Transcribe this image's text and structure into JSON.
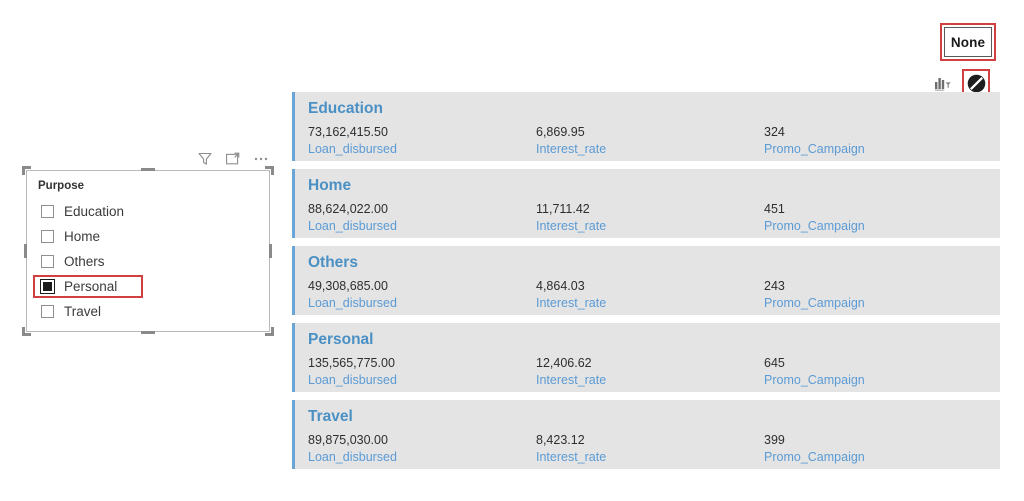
{
  "toolbar": {
    "none_button_label": "None",
    "icons": [
      {
        "name": "cross-filter-bar-chart-icon",
        "title": "Filter"
      },
      {
        "name": "no-interaction-icon",
        "title": "None"
      }
    ]
  },
  "slicer": {
    "title": "Purpose",
    "header_icons": [
      {
        "name": "filter-funnel-icon"
      },
      {
        "name": "focus-mode-icon"
      },
      {
        "name": "more-options-icon"
      }
    ],
    "items": [
      {
        "label": "Education",
        "checked": false
      },
      {
        "label": "Home",
        "checked": false
      },
      {
        "label": "Others",
        "checked": false
      },
      {
        "label": "Personal",
        "checked": true
      },
      {
        "label": "Travel",
        "checked": false
      }
    ]
  },
  "cards": {
    "column_labels": [
      "Loan_disbursed",
      "Interest_rate",
      "Promo_Campaign"
    ],
    "rows": [
      {
        "title": "Education",
        "values": [
          "73,162,415.50",
          "6,869.95",
          "324"
        ]
      },
      {
        "title": "Home",
        "values": [
          "88,624,022.00",
          "11,711.42",
          "451"
        ]
      },
      {
        "title": "Others",
        "values": [
          "49,308,685.00",
          "4,864.03",
          "243"
        ]
      },
      {
        "title": "Personal",
        "values": [
          "135,565,775.00",
          "12,406.62",
          "645"
        ]
      },
      {
        "title": "Travel",
        "values": [
          "89,875,030.00",
          "8,423.12",
          "399"
        ]
      }
    ]
  },
  "colors": {
    "accent_blue": "#5b9bd5",
    "card_bg": "#e4e4e4",
    "highlight_red": "#d14040",
    "title_blue": "#4a90c4"
  }
}
